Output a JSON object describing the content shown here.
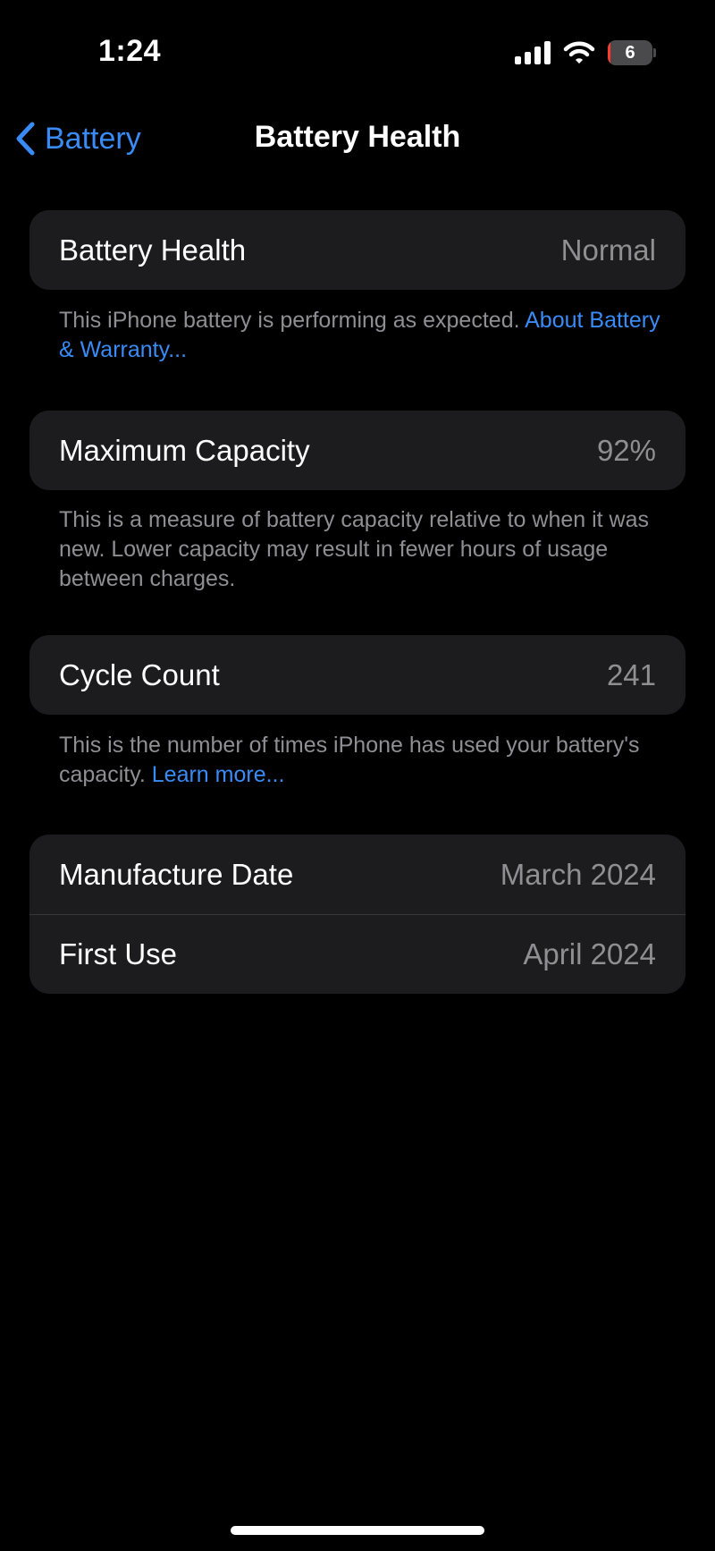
{
  "status_bar": {
    "time": "1:24",
    "battery_level": "6",
    "battery_fraction": 0.06,
    "battery_color": "#ff3b30",
    "icons": [
      "signal-icon",
      "wifi-icon",
      "battery-icon"
    ]
  },
  "nav": {
    "back_label": "Battery",
    "back_icon": "chevron-left-icon",
    "title": "Battery Health"
  },
  "health": {
    "label": "Battery Health",
    "value": "Normal",
    "note": "This iPhone battery is performing as expected.",
    "link": "About Battery & Warranty..."
  },
  "capacity": {
    "label": "Maximum Capacity",
    "value": "92%",
    "note": "This is a measure of battery capacity relative to when it was new. Lower capacity may result in fewer hours of usage between charges."
  },
  "cycles": {
    "label": "Cycle Count",
    "value": "241",
    "note": "This is the number of times iPhone has used your battery's capacity.",
    "link": "Learn more..."
  },
  "dates": {
    "manufacture_label": "Manufacture Date",
    "manufacture_value": "March 2024",
    "first_use_label": "First Use",
    "first_use_value": "April 2024"
  },
  "colors": {
    "accent": "#3a8bf5",
    "background": "#000000",
    "cell": "#1c1c1e",
    "secondary_text": "#8e8e93"
  }
}
